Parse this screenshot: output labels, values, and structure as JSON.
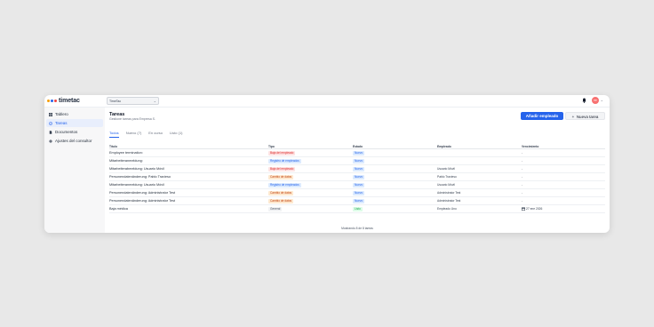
{
  "app": {
    "name": "timetac",
    "logo_colors": [
      "#f59e0b",
      "#2563eb",
      "#ef4444"
    ]
  },
  "topbar": {
    "company": "TimeTac",
    "avatar_initials": "TT"
  },
  "sidebar": {
    "items": [
      {
        "label": "Tablero",
        "icon": "grid-icon",
        "active": false
      },
      {
        "label": "Tareas",
        "icon": "check-circle-icon",
        "active": true
      },
      {
        "label": "Documentos",
        "icon": "document-icon",
        "active": false
      },
      {
        "label": "Ajustes del consultor",
        "icon": "gear-icon",
        "active": false
      }
    ]
  },
  "page": {
    "title": "Tareas",
    "subtitle": "Gestione tareas para Empresa S.",
    "add_employee": "Añadir empleado",
    "new_task": "Nueva tarea"
  },
  "tabs": [
    "Todos",
    "Nuevo (7)",
    "En curso",
    "Listo (1)"
  ],
  "table": {
    "headers": {
      "title": "Título",
      "type": "Tipo",
      "state": "Estado",
      "employee": "Empleado",
      "due": "Vencimiento"
    },
    "rows": [
      {
        "title": "Employee termination:",
        "type": "Baja del empleado",
        "type_color": "red",
        "state": "Nuevo",
        "state_color": "blue",
        "employee": "",
        "due": "-"
      },
      {
        "title": "Mitarbeiteranmeldung:",
        "type": "Registro de empleados",
        "type_color": "blue",
        "state": "Nuevo",
        "state_color": "blue",
        "employee": "",
        "due": "-"
      },
      {
        "title": "Mitarbeiterabmeldung: Usuario Móvil",
        "type": "Baja del empleado",
        "type_color": "red",
        "state": "Nuevo",
        "state_color": "blue",
        "employee": "Usuario Móvil",
        "due": "-"
      },
      {
        "title": "Personendatenänderung: Pablo Travieso",
        "type": "Cambio de datos",
        "type_color": "orange",
        "state": "Nuevo",
        "state_color": "blue",
        "employee": "Pablo Travieso",
        "due": "-"
      },
      {
        "title": "Mitarbeiteranmeldung: Usuario Móvil",
        "type": "Registro de empleados",
        "type_color": "blue",
        "state": "Nuevo",
        "state_color": "blue",
        "employee": "Usuario Móvil",
        "due": "-"
      },
      {
        "title": "Personendatenänderung: Administrator Test",
        "type": "Cambio de datos",
        "type_color": "orange",
        "state": "Nuevo",
        "state_color": "blue",
        "employee": "Administrator Test",
        "due": "-"
      },
      {
        "title": "Personendatenänderung: Administrator Test",
        "type": "Cambio de datos",
        "type_color": "orange",
        "state": "Nuevo",
        "state_color": "blue",
        "employee": "Administrator Test",
        "due": "-"
      },
      {
        "title": "Baja médica",
        "type": "General",
        "type_color": "gray",
        "state": "Listo",
        "state_color": "green",
        "employee": "Empleado Uno",
        "due": "27 ene 2026",
        "due_icon": "calendar-icon"
      }
    ]
  },
  "footer": "Mostrando 8 de 8 tareas",
  "badge_colors": {
    "red": {
      "bg": "#fde2e2",
      "fg": "#dc2626"
    },
    "blue": {
      "bg": "#dbeafe",
      "fg": "#2563eb"
    },
    "orange": {
      "bg": "#fde8cf",
      "fg": "#c2410c"
    },
    "gray": {
      "bg": "#f1f2f4",
      "fg": "#4b5563"
    },
    "green": {
      "bg": "#dcfce7",
      "fg": "#16a34a"
    }
  }
}
